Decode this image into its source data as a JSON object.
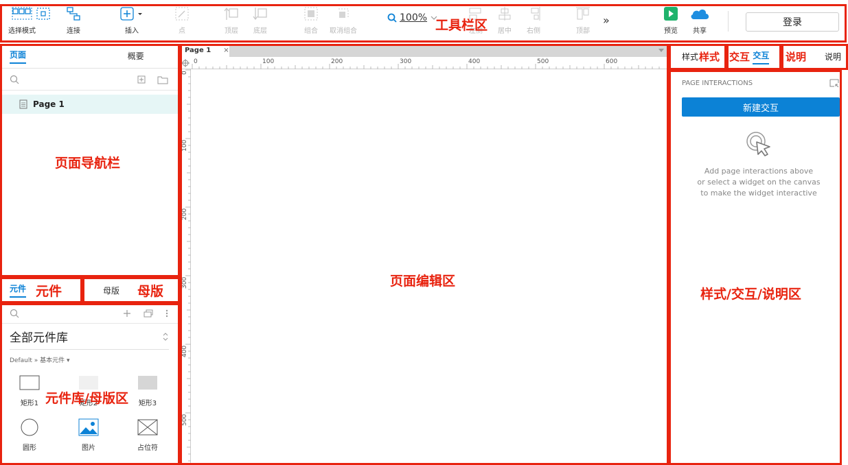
{
  "toolbar": {
    "select_mode": "选择模式",
    "connect": "连接",
    "insert": "插入",
    "point": "点",
    "top_layer": "顶层",
    "bottom_layer": "底层",
    "group": "组合",
    "ungroup": "取消组合",
    "zoom_value": "100%",
    "align_left": "左侧",
    "align_center": "居中",
    "align_right": "右侧",
    "align_top": "顶部",
    "more": "»",
    "preview": "预览",
    "share": "共享",
    "login": "登录"
  },
  "left_panel": {
    "tabs": [
      "页面",
      "概要"
    ],
    "pages": [
      {
        "label": "Page 1"
      }
    ],
    "library_tabs": [
      "元件",
      "母版"
    ],
    "library_select": "全部元件库",
    "library_path": "Default » 基本元件 ▾",
    "widgets": [
      "矩形1",
      "矩形2",
      "矩形3",
      "圆形",
      "图片",
      "占位符"
    ]
  },
  "canvas": {
    "tab_label": "Page 1",
    "tab_close": "×",
    "ruler_h": [
      "0",
      "100",
      "200",
      "300",
      "400",
      "500",
      "600"
    ],
    "ruler_v": [
      "0",
      "100",
      "200",
      "300",
      "400",
      "500"
    ]
  },
  "right_panel": {
    "tabs": [
      "样式",
      "交互",
      "说明"
    ],
    "section_title": "PAGE INTERACTIONS",
    "new_interaction": "新建交互",
    "empty_text": [
      "Add page interactions above",
      "or select a widget on the canvas",
      "to make the widget interactive"
    ]
  },
  "annotations": {
    "toolbar_area": "工具栏区",
    "page_nav": "页面导航栏",
    "widgets_tab": "元件",
    "masters_tab": "母版",
    "library_area": "元件库/母版区",
    "canvas_area": "页面编辑区",
    "style_tab": "样式",
    "interaction_tab": "交互",
    "notes_tab": "说明",
    "right_area": "样式/交互/说明区"
  },
  "colors": {
    "accent": "#0c82d6",
    "annotation": "#e8230f",
    "preview_green": "#1fb36c",
    "share_blue": "#1f8ee0"
  }
}
